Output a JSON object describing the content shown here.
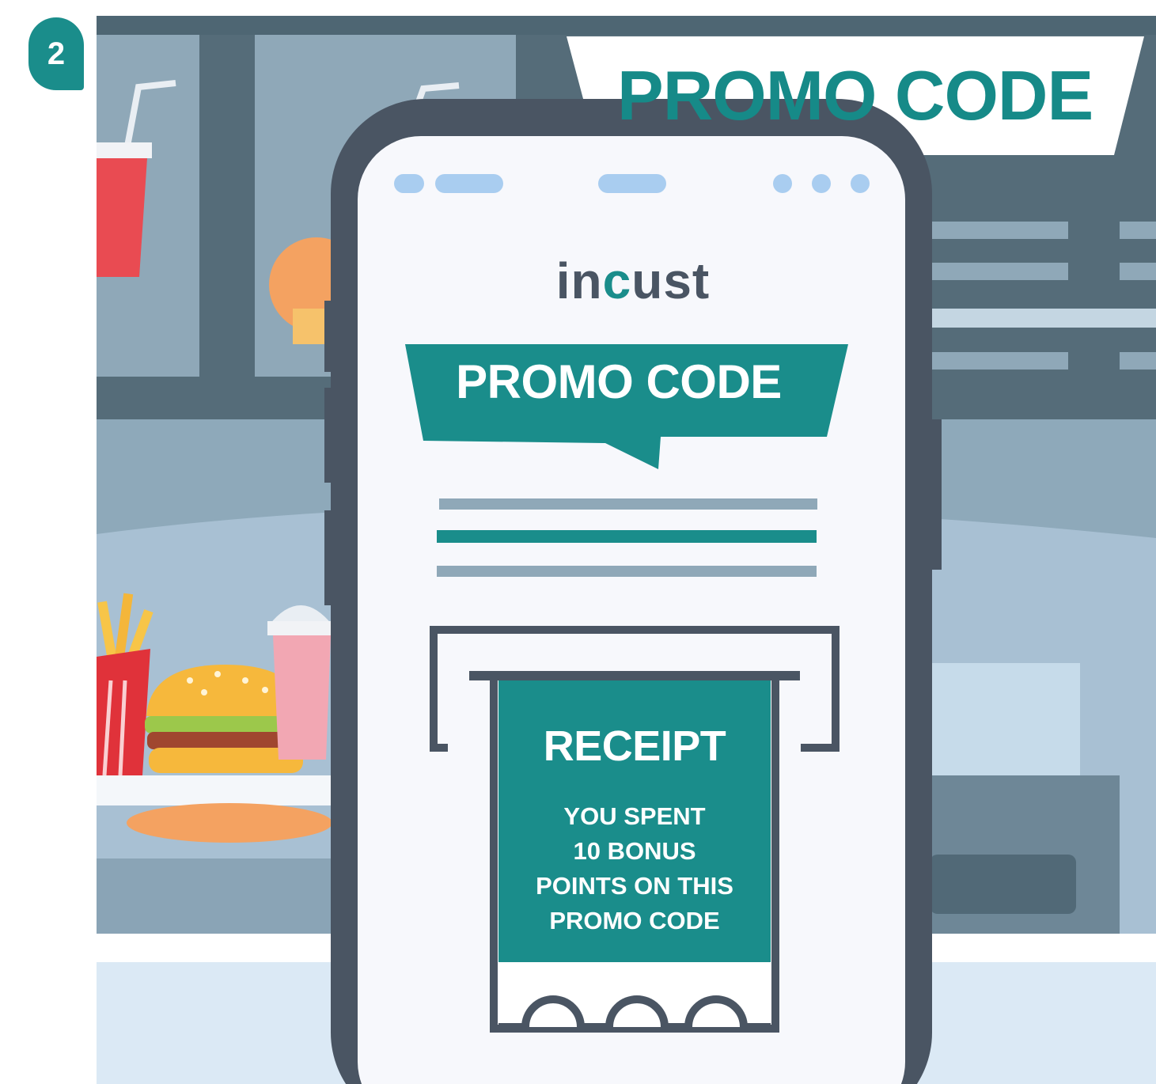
{
  "step": {
    "number": "2"
  },
  "store_sign": {
    "text": "PROMO CODE"
  },
  "app": {
    "logo": {
      "prefix": "in",
      "mark": "c",
      "suffix": "ust"
    },
    "banner": {
      "text": "PROMO CODE"
    },
    "receipt": {
      "title": "RECEIPT",
      "lines": [
        "YOU SPENT",
        "10 BONUS",
        "POINTS ON THIS",
        "PROMO CODE"
      ]
    }
  },
  "colors": {
    "brand_teal": "#1a8d8b",
    "phone_frame": "#4a5563",
    "screen_bg": "#f7f8fc",
    "status_pills": "#a9cdf0",
    "wall": "#8faabb",
    "counter": "#dbe9f5"
  }
}
